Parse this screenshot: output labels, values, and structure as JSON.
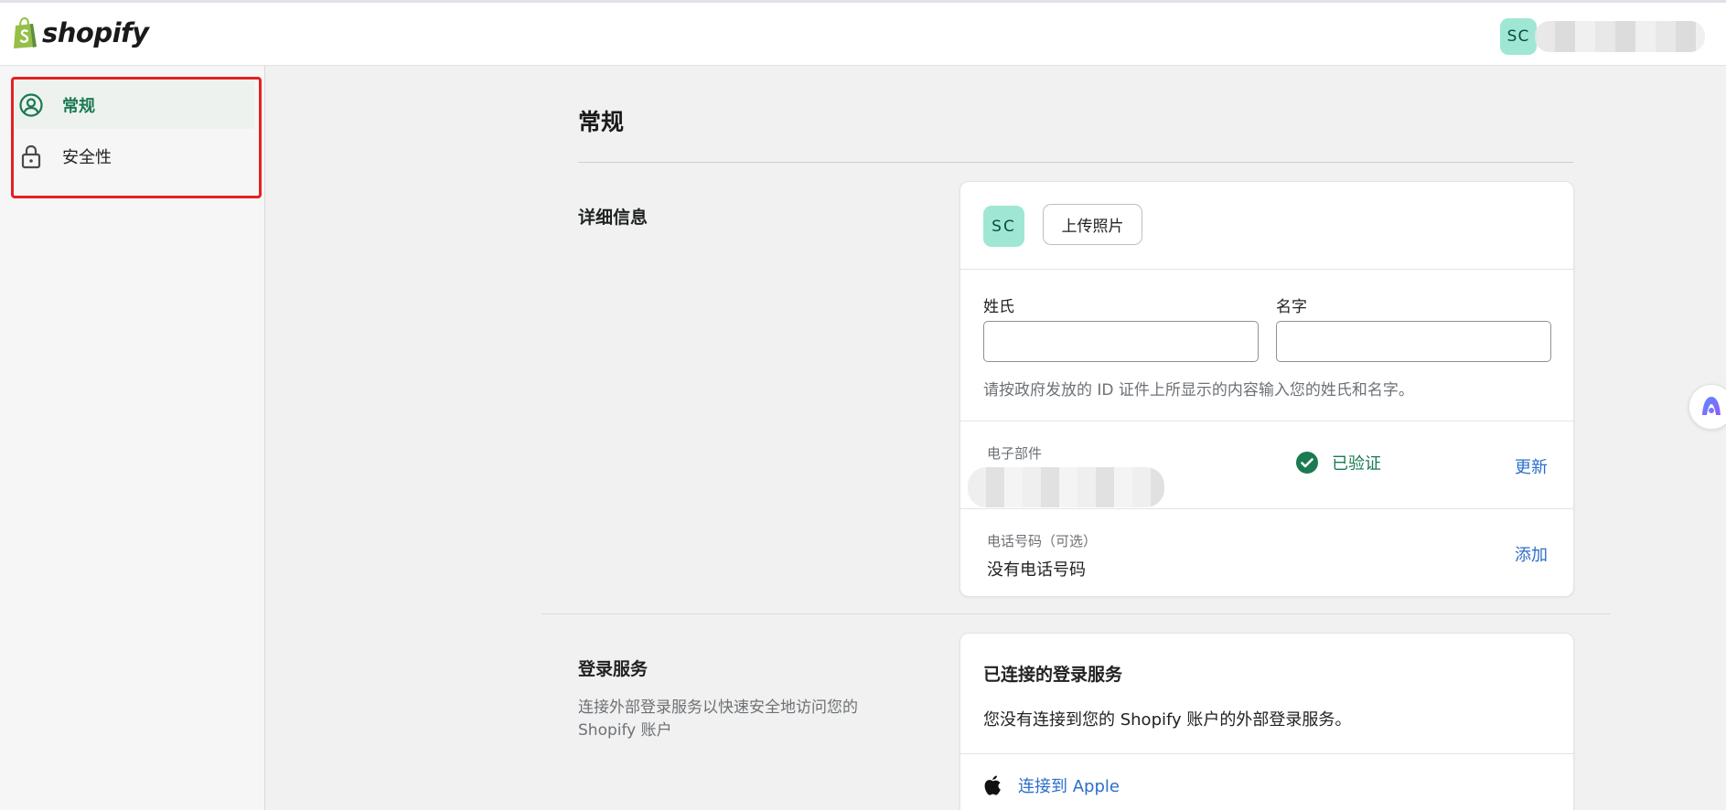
{
  "header": {
    "logo_text": "shopify",
    "user_initials": "SC"
  },
  "sidebar": {
    "items": [
      {
        "label": "常规",
        "icon": "user-circle-icon",
        "active": true
      },
      {
        "label": "安全性",
        "icon": "lock-icon",
        "active": false
      }
    ]
  },
  "page": {
    "title": "常规"
  },
  "details": {
    "section_label": "详细信息",
    "avatar_initials": "SC",
    "upload_label": "上传照片",
    "last_name_label": "姓氏",
    "last_name_value": "",
    "first_name_label": "名字",
    "first_name_value": "",
    "name_help": "请按政府发放的 ID 证件上所显示的内容输入您的姓氏和名字。",
    "email_label": "电子部件",
    "email_status": "已验证",
    "email_action": "更新",
    "phone_label": "电话号码（可选）",
    "phone_value": "没有电话号码",
    "phone_action": "添加"
  },
  "login_services": {
    "section_label": "登录服务",
    "section_desc": "连接外部登录服务以快速安全地访问您的 Shopify 账户",
    "card_title": "已连接的登录服务",
    "card_text": "您没有连接到您的 Shopify 账户的外部登录服务。",
    "apple_label": "连接到 Apple"
  },
  "colors": {
    "accent_green": "#1a7a52",
    "link_blue": "#2c6ecb",
    "avatar_bg": "#9fe7d4",
    "highlight_red": "#e32121"
  }
}
